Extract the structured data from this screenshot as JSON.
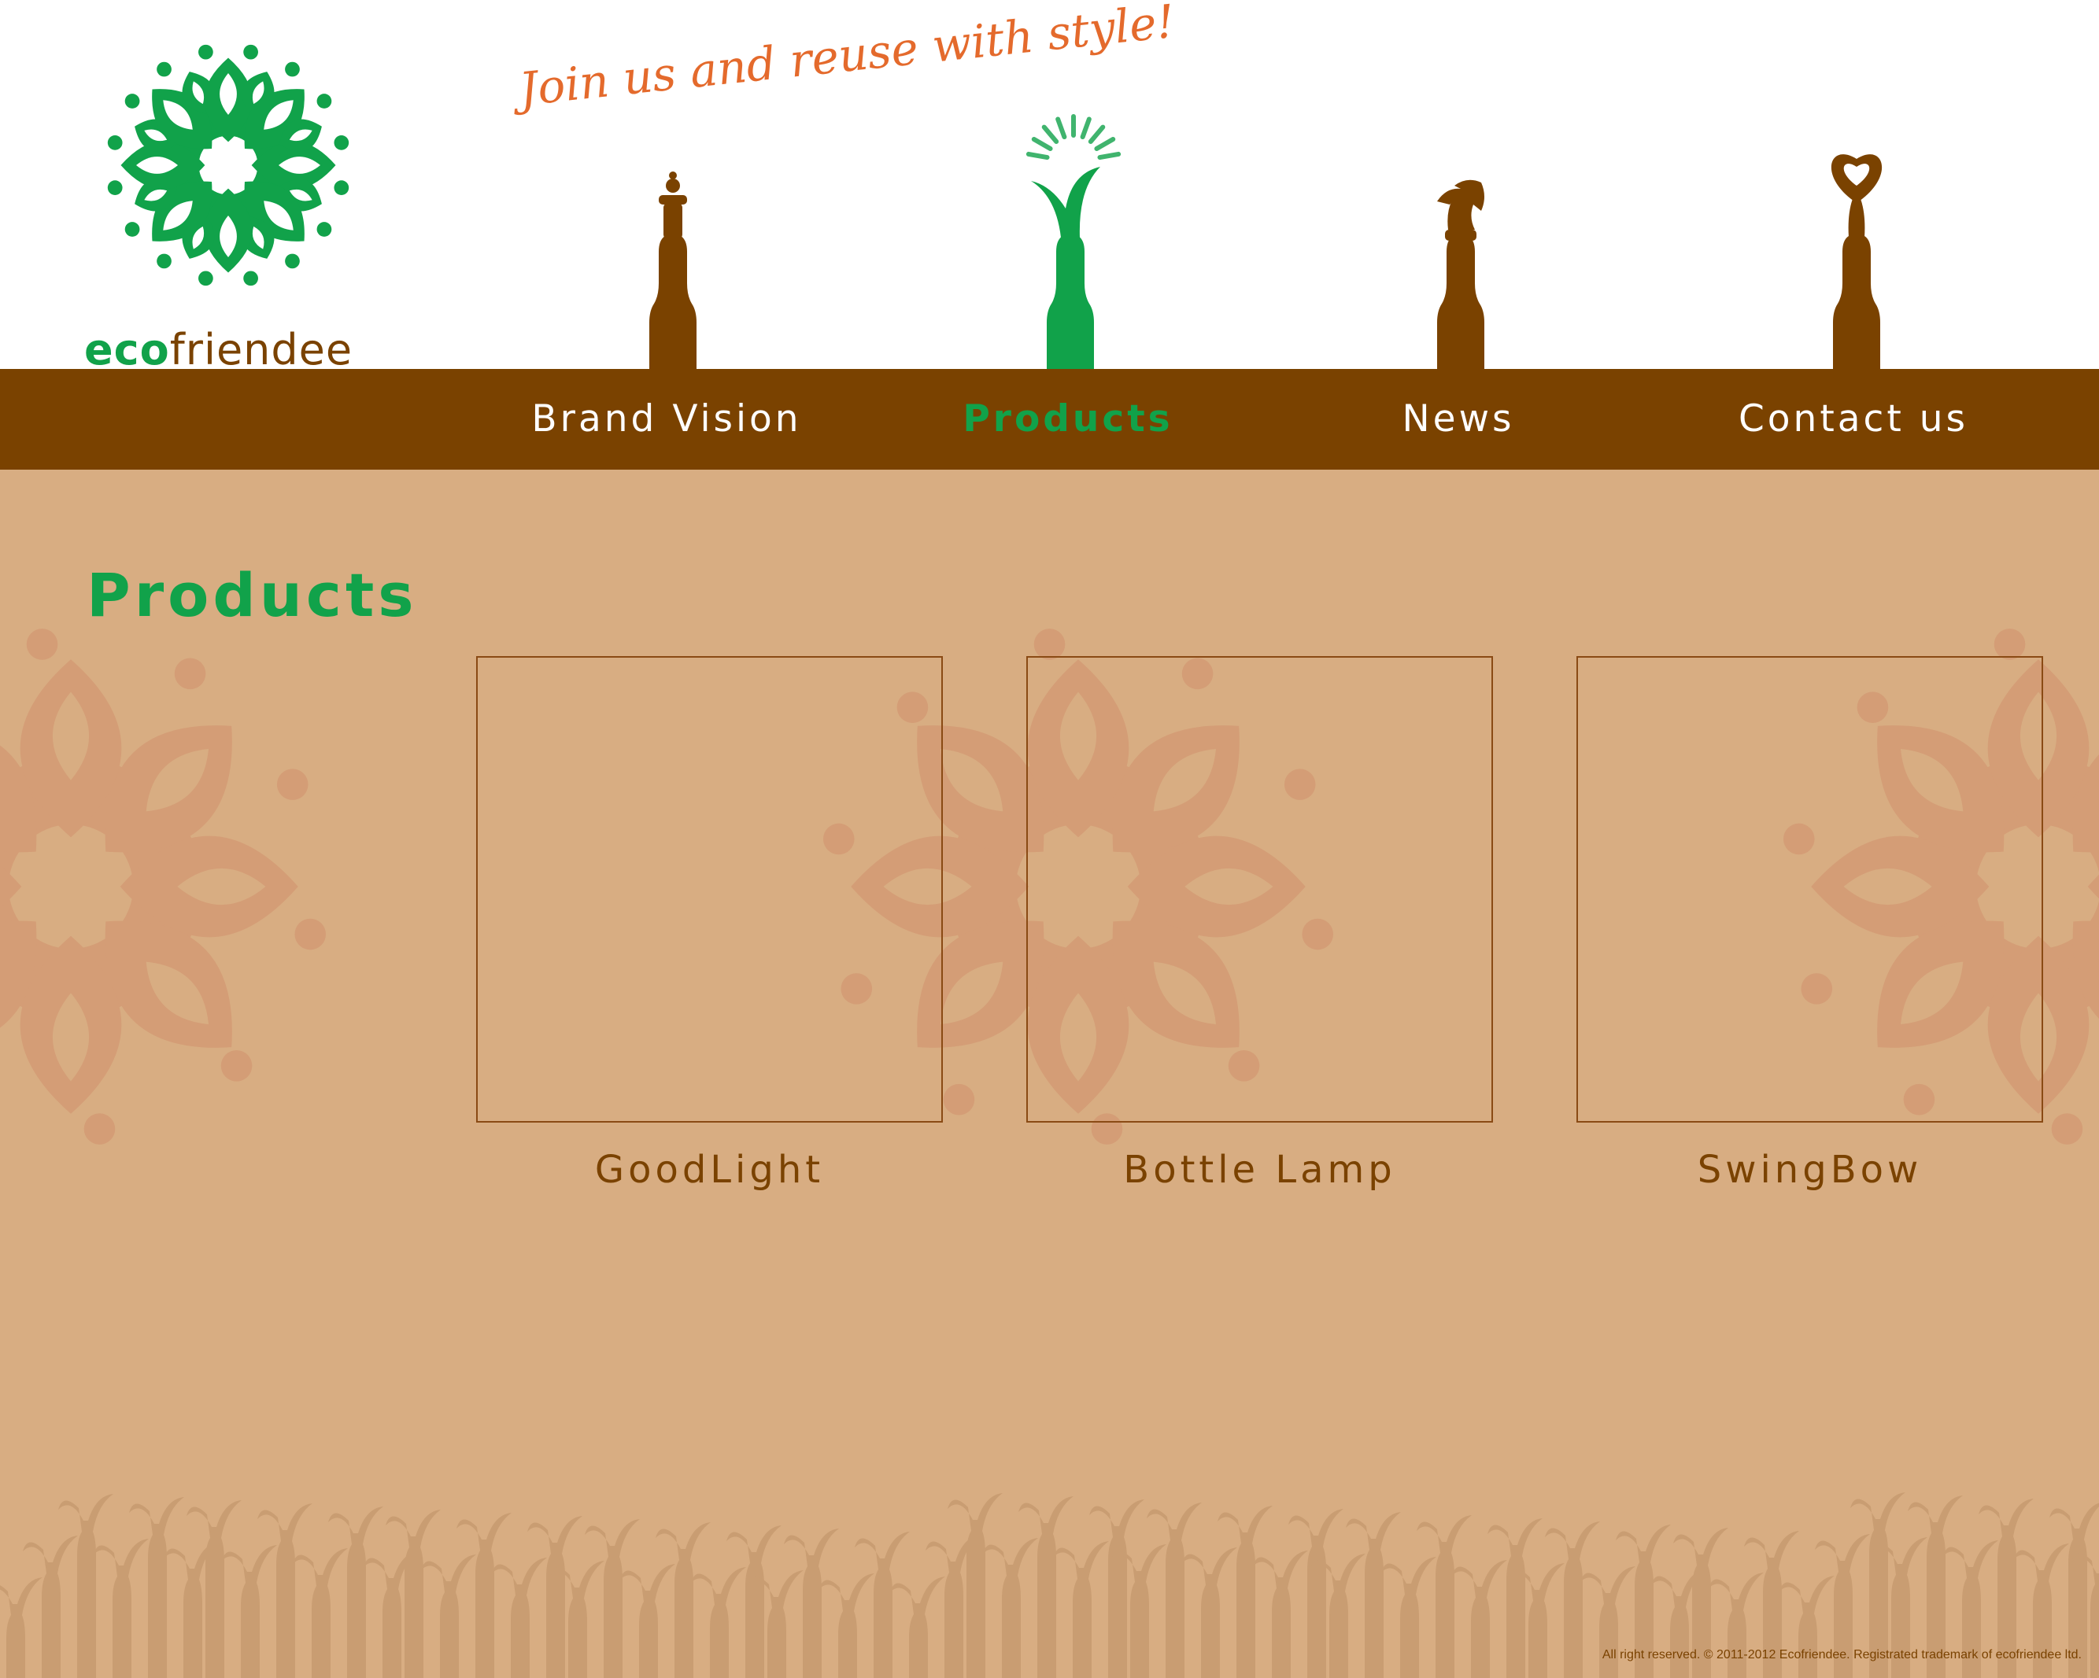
{
  "colors": {
    "green": "#11a24a",
    "brown": "#7a4200",
    "bg_tan": "#d8ad82",
    "pattern": "#d49d76",
    "grass": "#c99d72",
    "tagline": "#e46a2c",
    "white": "#ffffff"
  },
  "brand": {
    "logo_icon": "flower-icon",
    "name_eco": "eco",
    "name_rest": "friendee"
  },
  "tagline": "Join us and reuse with style!",
  "nav": {
    "items": [
      {
        "label": "Brand Vision",
        "icon": "queen-bottle-icon",
        "active": false
      },
      {
        "label": "Products",
        "icon": "sprout-bottle-icon",
        "active": true
      },
      {
        "label": "News",
        "icon": "knight-bottle-icon",
        "active": false
      },
      {
        "label": "Contact us",
        "icon": "heart-bottle-icon",
        "active": false
      }
    ]
  },
  "page": {
    "title": "Products"
  },
  "products": [
    {
      "name": "GoodLight"
    },
    {
      "name": "Bottle Lamp"
    },
    {
      "name": "SwingBow"
    }
  ],
  "footer": {
    "copyright": "All right reserved. © 2011-2012 Ecofriendee. Registrated trademark of ecofriendee ltd."
  }
}
